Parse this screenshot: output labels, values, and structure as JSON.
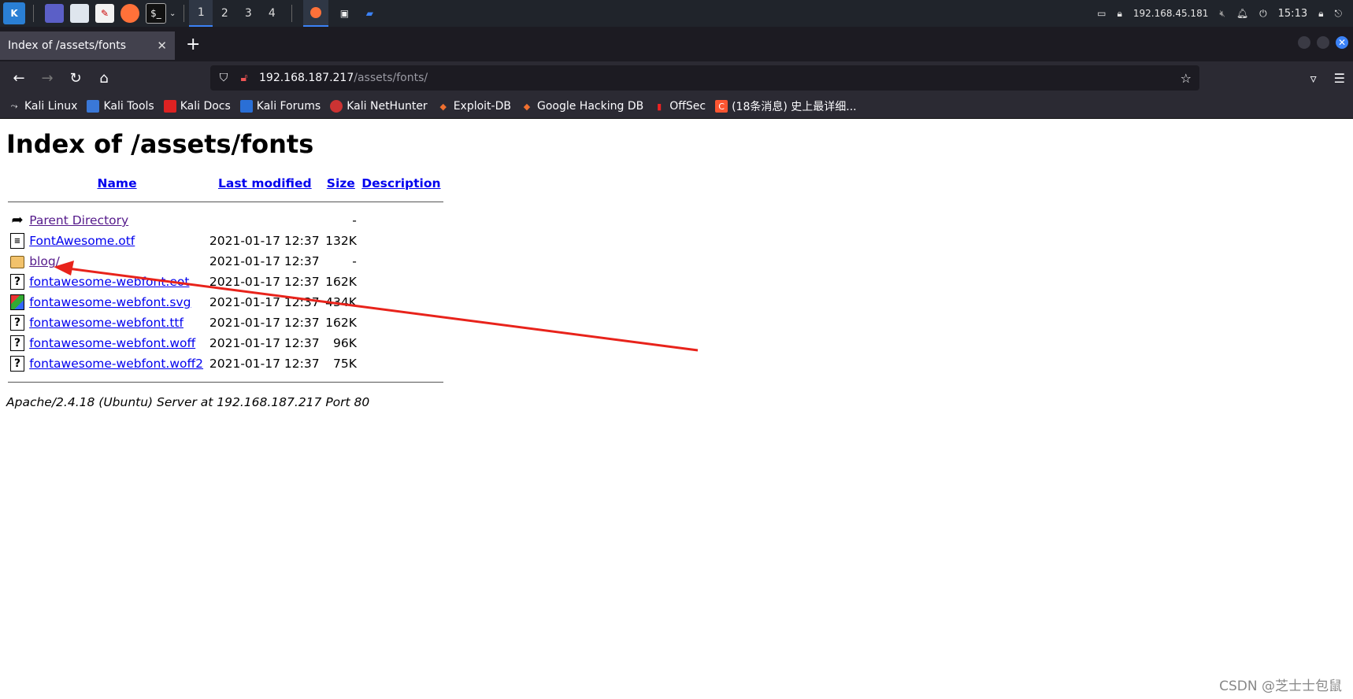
{
  "taskbar": {
    "workspaces": [
      "1",
      "2",
      "3",
      "4"
    ],
    "active_workspace": "1",
    "ip": "192.168.45.181",
    "clock": "15:13"
  },
  "browser": {
    "tab_title": "Index of /assets/fonts",
    "url_host": "192.168.187.217",
    "url_path": "/assets/fonts/",
    "bookmarks": [
      "Kali Linux",
      "Kali Tools",
      "Kali Docs",
      "Kali Forums",
      "Kali NetHunter",
      "Exploit-DB",
      "Google Hacking DB",
      "OffSec",
      "(18条消息) 史上最详细..."
    ]
  },
  "page": {
    "heading": "Index of /assets/fonts",
    "columns": {
      "name": "Name",
      "last_modified": "Last modified",
      "size": "Size",
      "description": "Description"
    },
    "rows": [
      {
        "name": "Parent Directory",
        "modified": "",
        "size": "-",
        "icon": "back-icon"
      },
      {
        "name": "FontAwesome.otf",
        "modified": "2021-01-17 12:37",
        "size": "132K",
        "icon": "file-icon"
      },
      {
        "name": "blog/",
        "modified": "2021-01-17 12:37",
        "size": "-",
        "icon": "folder-icon"
      },
      {
        "name": "fontawesome-webfont.eot",
        "modified": "2021-01-17 12:37",
        "size": "162K",
        "icon": "unknown-file-icon"
      },
      {
        "name": "fontawesome-webfont.svg",
        "modified": "2021-01-17 12:37",
        "size": "434K",
        "icon": "image-file-icon"
      },
      {
        "name": "fontawesome-webfont.ttf",
        "modified": "2021-01-17 12:37",
        "size": "162K",
        "icon": "unknown-file-icon"
      },
      {
        "name": "fontawesome-webfont.woff",
        "modified": "2021-01-17 12:37",
        "size": "96K",
        "icon": "unknown-file-icon"
      },
      {
        "name": "fontawesome-webfont.woff2",
        "modified": "2021-01-17 12:37",
        "size": "75K",
        "icon": "unknown-file-icon"
      }
    ],
    "address": "Apache/2.4.18 (Ubuntu) Server at 192.168.187.217 Port 80"
  },
  "watermark": "CSDN @芝士士包鼠",
  "colors": {
    "link": "#0000ee",
    "visited_link": "#551a8b",
    "annotation_arrow": "#e8231b"
  }
}
